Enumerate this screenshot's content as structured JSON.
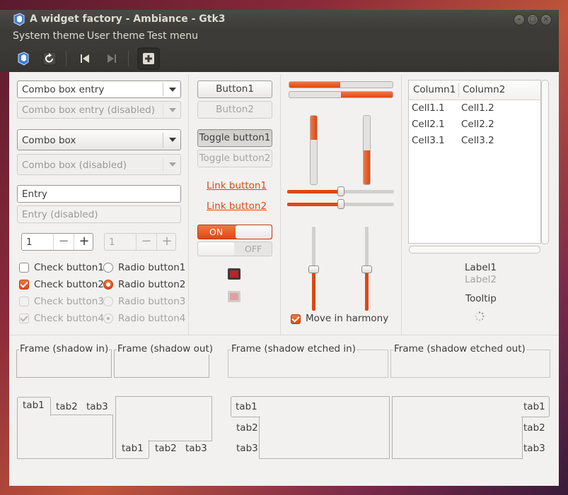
{
  "window": {
    "title": "A widget factory - Ambiance - Gtk3"
  },
  "menu": {
    "items": [
      "System theme",
      "User theme",
      "Test menu"
    ]
  },
  "col1": {
    "combo_entry": "Combo box entry",
    "combo_entry_disabled": "Combo box entry (disabled)",
    "combo_box": "Combo box",
    "combo_box_disabled": "Combo box (disabled)",
    "entry": "Entry",
    "entry_disabled": "Entry (disabled)",
    "spin1": "1",
    "spin2": "1",
    "spin_minus": "−",
    "spin_plus": "+",
    "check1": "Check button1",
    "check2": "Check button2",
    "check3": "Check button3",
    "check4": "Check button4",
    "radio1": "Radio button1",
    "radio2": "Radio button2",
    "radio3": "Radio button3",
    "radio4": "Radio button4"
  },
  "col2": {
    "button1": "Button1",
    "button2": "Button2",
    "toggle1": "Toggle button1",
    "toggle2": "Toggle button2",
    "link1": "Link button1",
    "link2": "Link button2",
    "switch_on": "ON",
    "switch_off": "OFF"
  },
  "col3": {
    "progress1": 0.49,
    "progress2": 0.5,
    "vprogress1": 0.35,
    "vprogress2": 0.5,
    "hscale1": 0.5,
    "hscale2": 0.5,
    "vscale1": 0.5,
    "vscale2": 0.5,
    "harmony": "Move in harmony"
  },
  "col4": {
    "tree": {
      "columns": [
        "Column1",
        "Column2"
      ],
      "rows": [
        [
          "Cell1.1",
          "Cell1.2"
        ],
        [
          "Cell2.1",
          "Cell2.2"
        ],
        [
          "Cell3.1",
          "Cell3.2"
        ]
      ]
    },
    "label1": "Label1",
    "label2": "Label2",
    "tooltip": "Tooltip"
  },
  "frames": [
    "Frame (shadow in)",
    "Frame (shadow out)",
    "Frame (shadow etched in)",
    "Frame (shadow etched out)"
  ],
  "tabs": [
    "tab1",
    "tab2",
    "tab3"
  ],
  "colors": {
    "accent": "#dd4814",
    "titlebar": "#3c3b37",
    "window_bg": "#f2f1f0"
  }
}
